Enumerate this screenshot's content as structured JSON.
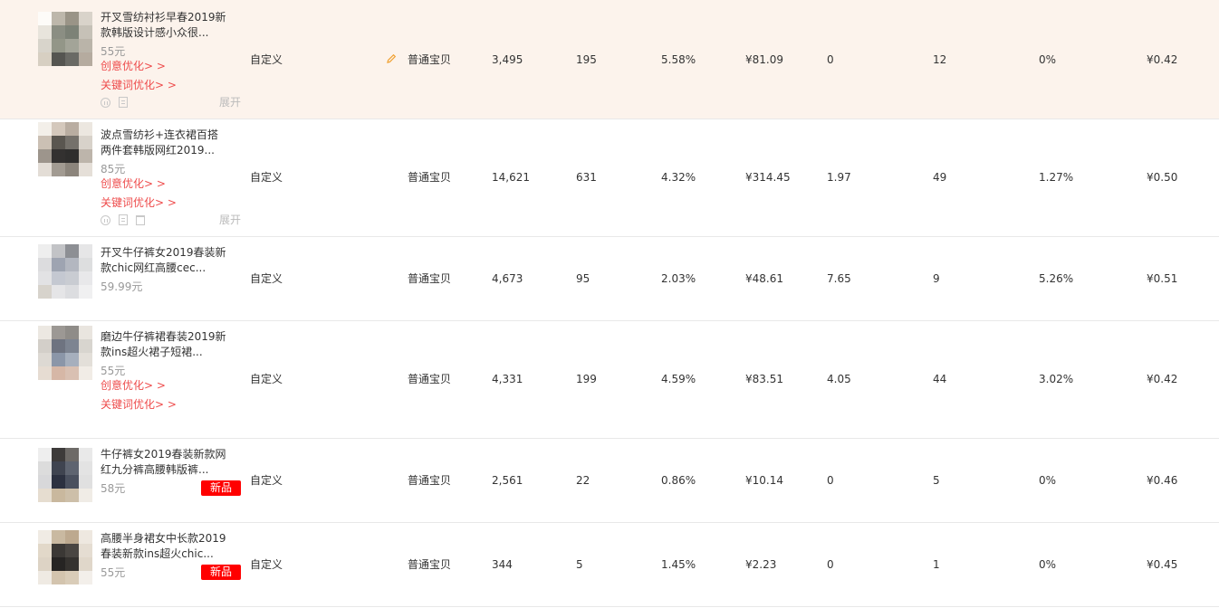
{
  "colors": {
    "highlight_row": "#fcf3ec",
    "link": "#ee4b4b",
    "badge": "#ff0000",
    "pencil": "#f0a030"
  },
  "actions": {
    "expand_label": "展开",
    "icons": [
      "pause-icon",
      "clipboard-icon",
      "trash-icon"
    ]
  },
  "rows": [
    {
      "title": "开叉雪纺衬衫早春2019新款韩版设计感小众很...",
      "price": "55元",
      "creative_link": "创意优化> >",
      "keyword_link": "关键词优化> >",
      "badge": "",
      "type": "自定义",
      "kind": "普通宝贝",
      "impressions": "3,495",
      "clicks": "195",
      "ctr": "5.58%",
      "cost": "¥81.09",
      "roi": "0",
      "collects": "12",
      "cvr": "0%",
      "ppc": "¥0.42"
    },
    {
      "title": "波点雪纺衫+连衣裙百搭两件套韩版网红2019...",
      "price": "85元",
      "creative_link": "创意优化> >",
      "keyword_link": "关键词优化> >",
      "badge": "",
      "type": "自定义",
      "kind": "普通宝贝",
      "impressions": "14,621",
      "clicks": "631",
      "ctr": "4.32%",
      "cost": "¥314.45",
      "roi": "1.97",
      "collects": "49",
      "cvr": "1.27%",
      "ppc": "¥0.50"
    },
    {
      "title": "开叉牛仔裤女2019春装新款chic网红高腰cec...",
      "price": "59.99元",
      "creative_link": "",
      "keyword_link": "",
      "badge": "",
      "type": "自定义",
      "kind": "普通宝贝",
      "impressions": "4,673",
      "clicks": "95",
      "ctr": "2.03%",
      "cost": "¥48.61",
      "roi": "7.65",
      "collects": "9",
      "cvr": "5.26%",
      "ppc": "¥0.51"
    },
    {
      "title": "磨边牛仔裤裙春装2019新款ins超火裙子短裙...",
      "price": "55元",
      "creative_link": "创意优化> >",
      "keyword_link": "关键词优化> >",
      "badge": "",
      "type": "自定义",
      "kind": "普通宝贝",
      "impressions": "4,331",
      "clicks": "199",
      "ctr": "4.59%",
      "cost": "¥83.51",
      "roi": "4.05",
      "collects": "44",
      "cvr": "3.02%",
      "ppc": "¥0.42"
    },
    {
      "title": "牛仔裤女2019春装新款网红九分裤高腰韩版裤...",
      "price": "58元",
      "creative_link": "",
      "keyword_link": "",
      "badge": "新品",
      "type": "自定义",
      "kind": "普通宝贝",
      "impressions": "2,561",
      "clicks": "22",
      "ctr": "0.86%",
      "cost": "¥10.14",
      "roi": "0",
      "collects": "5",
      "cvr": "0%",
      "ppc": "¥0.46"
    },
    {
      "title": "高腰半身裙女中长款2019春装新款ins超火chic...",
      "price": "55元",
      "creative_link": "",
      "keyword_link": "",
      "badge": "新品",
      "type": "自定义",
      "kind": "普通宝贝",
      "impressions": "344",
      "clicks": "5",
      "ctr": "1.45%",
      "cost": "¥2.23",
      "roi": "0",
      "collects": "1",
      "cvr": "0%",
      "ppc": "¥0.45"
    }
  ]
}
